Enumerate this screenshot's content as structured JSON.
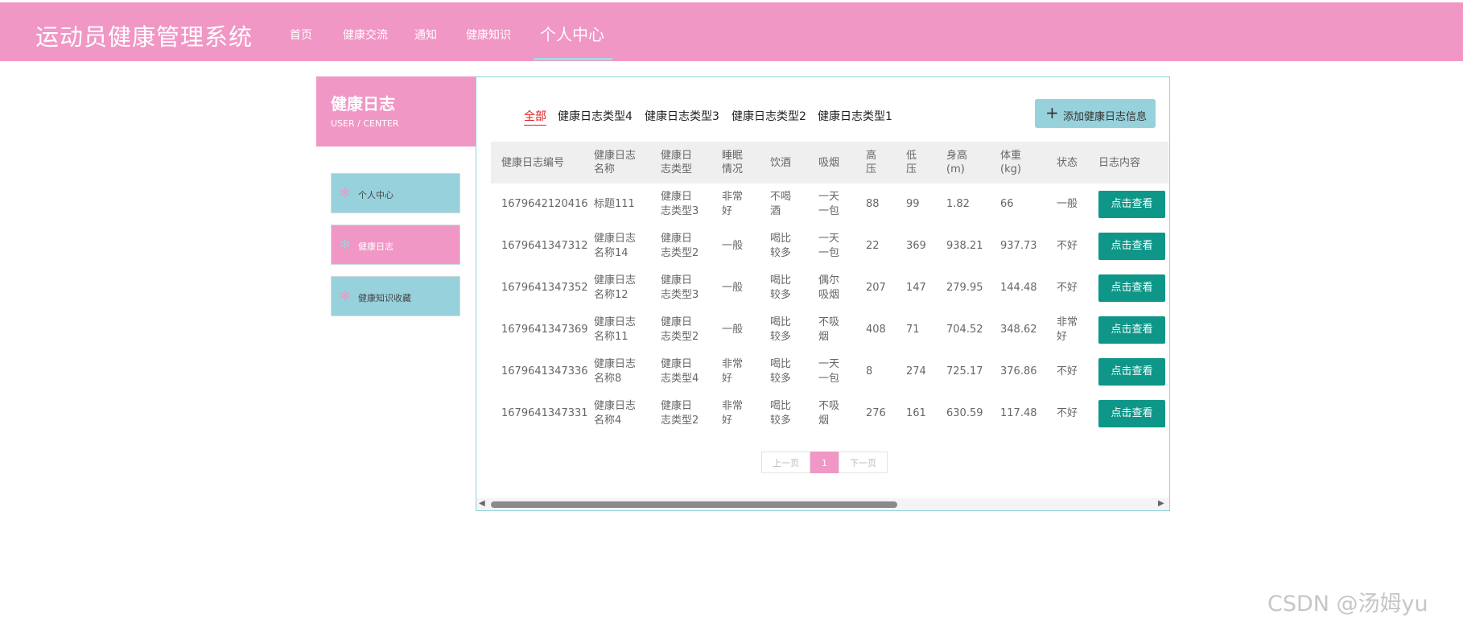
{
  "header": {
    "app_title": "运动员健康管理系统",
    "nav": [
      "首页",
      "健康交流",
      "通知",
      "健康知识",
      "个人中心"
    ],
    "active_nav": "个人中心"
  },
  "sidebar": {
    "title": "健康日志",
    "subtitle": "USER / CENTER",
    "items": [
      {
        "label": "个人中心",
        "icon": "asterisk-icon"
      },
      {
        "label": "健康日志",
        "icon": "asterisk-icon",
        "active": true
      },
      {
        "label": "健康知识收藏",
        "icon": "asterisk-icon"
      }
    ]
  },
  "filters": [
    "全部",
    "健康日志类型4",
    "健康日志类型3",
    "健康日志类型2",
    "健康日志类型1"
  ],
  "active_filter": "全部",
  "add_button": {
    "icon": "plus-icon",
    "label": "添加健康日志信息"
  },
  "table": {
    "columns": [
      "健康日志编号",
      "健康日志名称",
      "健康日志类型",
      "睡眠情况",
      "饮酒",
      "吸烟",
      "高压",
      "低压",
      "身高(m)",
      "体重(kg)",
      "状态",
      "日志内容"
    ],
    "rows": [
      [
        "1679642120416",
        "标题111",
        "健康日志类型3",
        "非常好",
        "不喝酒",
        "一天一包",
        "88",
        "99",
        "1.82",
        "66",
        "一般",
        "点击查看"
      ],
      [
        "1679641347312",
        "健康日志名称14",
        "健康日志类型2",
        "一般",
        "喝比较多",
        "一天一包",
        "22",
        "369",
        "938.21",
        "937.73",
        "不好",
        "点击查看"
      ],
      [
        "1679641347352",
        "健康日志名称12",
        "健康日志类型3",
        "一般",
        "喝比较多",
        "偶尔吸烟",
        "207",
        "147",
        "279.95",
        "144.48",
        "不好",
        "点击查看"
      ],
      [
        "1679641347369",
        "健康日志名称11",
        "健康日志类型2",
        "一般",
        "喝比较多",
        "不吸烟",
        "408",
        "71",
        "704.52",
        "348.62",
        "非常好",
        "点击查看"
      ],
      [
        "1679641347336",
        "健康日志名称8",
        "健康日志类型4",
        "非常好",
        "喝比较多",
        "一天一包",
        "8",
        "274",
        "725.17",
        "376.86",
        "不好",
        "点击查看"
      ],
      [
        "1679641347331",
        "健康日志名称4",
        "健康日志类型2",
        "非常好",
        "喝比较多",
        "不吸烟",
        "276",
        "161",
        "630.59",
        "117.48",
        "不好",
        "点击查看"
      ]
    ]
  },
  "pagination": {
    "prev": "上一页",
    "current": "1",
    "next": "下一页"
  },
  "watermark": "CSDN @汤姆yu",
  "colors": {
    "brand_pink": "#f097c5",
    "accent_cyan": "#97d2dc",
    "button_teal": "#0e9688",
    "filter_active_red": "#e0201f"
  }
}
